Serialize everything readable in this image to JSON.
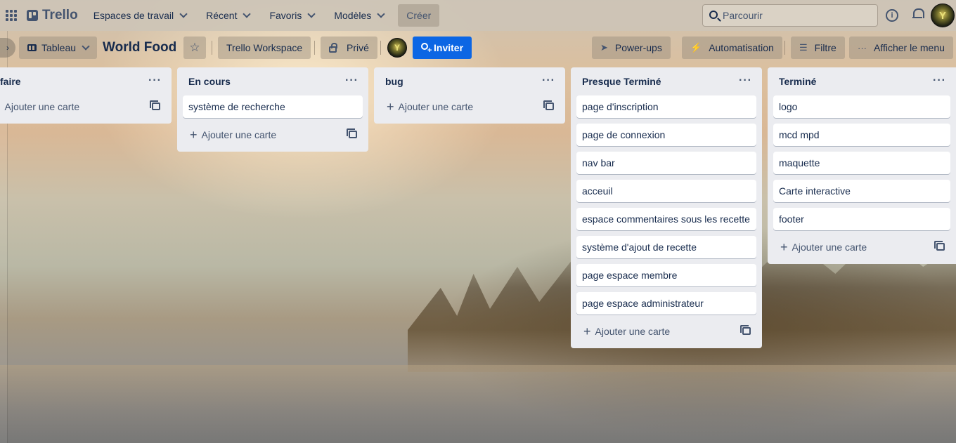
{
  "topbar": {
    "logo": "Trello",
    "nav": [
      {
        "label": "Espaces de travail"
      },
      {
        "label": "Récent"
      },
      {
        "label": "Favoris"
      },
      {
        "label": "Modèles"
      }
    ],
    "create": "Créer",
    "search_placeholder": "Parcourir",
    "info_glyph": "i"
  },
  "board": {
    "view": "Tableau",
    "title": "World Food",
    "star_glyph": "☆",
    "workspace": "Trello Workspace",
    "visibility": "Privé",
    "invite": "Inviter",
    "powerups": "Power-ups",
    "automation": "Automatisation",
    "filter": "Filtre",
    "menu": "Afficher le menu",
    "collapse_glyph": "›",
    "powerups_glyph": "➤",
    "automation_glyph": "⚡",
    "filter_glyph": "☰",
    "menu_glyph": "···"
  },
  "avatar_glyph": "Y",
  "add_card_label": "Ajouter une carte",
  "list_menu_glyph": "···",
  "plus_glyph": "+",
  "lists": [
    {
      "title": "faire",
      "cards": []
    },
    {
      "title": "En cours",
      "cards": [
        "système de recherche"
      ]
    },
    {
      "title": "bug",
      "cards": []
    },
    {
      "title": "Presque Terminé",
      "cards": [
        "page d'inscription",
        "page de connexion",
        "nav bar",
        "acceuil",
        "espace commentaires sous les recette",
        "système d'ajout de recette",
        "page espace membre",
        "page espace administrateur"
      ]
    },
    {
      "title": "Terminé",
      "cards": [
        "logo",
        "mcd mpd",
        "maquette",
        "Carte interactive",
        "footer"
      ]
    }
  ],
  "colors": {
    "invite_button": "#0c66e4",
    "list_background": "#ebecf0",
    "card_background": "#ffffff"
  }
}
